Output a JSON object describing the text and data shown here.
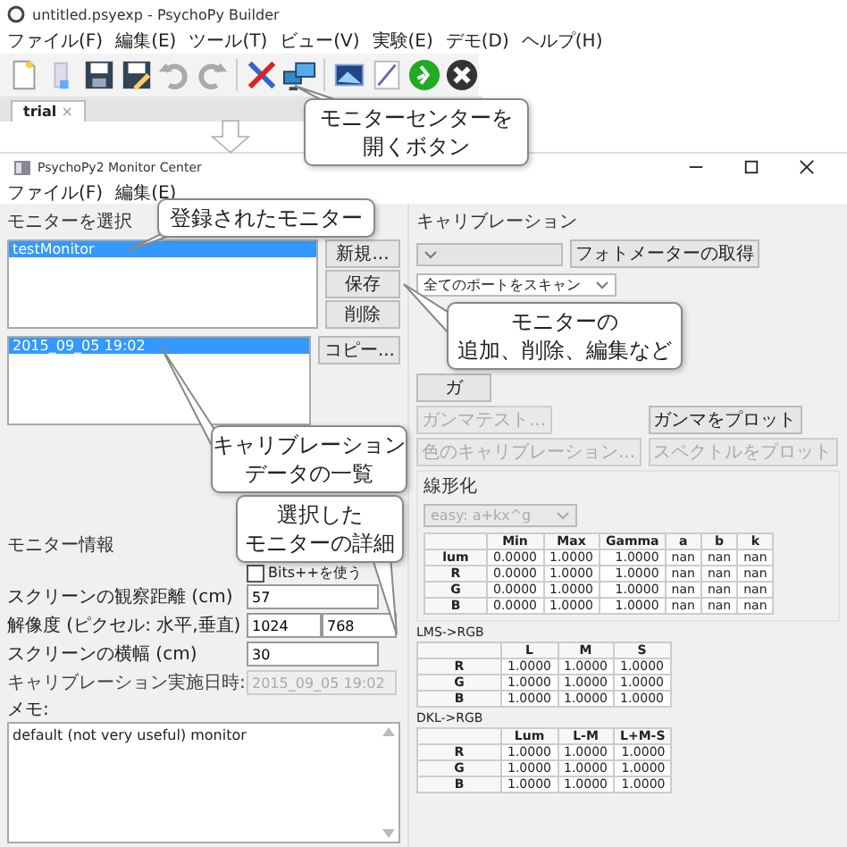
{
  "builder_window": {
    "title": "untitled.psyexp - PsychoPy Builder",
    "menu": [
      "ファイル(F)",
      "編集(E)",
      "ツール(T)",
      "ビュー(V)",
      "実験(E)",
      "デモ(D)",
      "ヘルプ(H)"
    ],
    "tabs": [
      {
        "label": "trial",
        "close": "×",
        "selected": true
      }
    ]
  },
  "monitor_center": {
    "title": "PsychoPy2 Monitor Center",
    "menu": [
      "ファイル(F)",
      "編集(E)"
    ],
    "select_panel": {
      "heading": "モニターを選択",
      "monitors": [
        {
          "name": "testMonitor",
          "selected": true
        }
      ],
      "monitor_buttons": [
        "新規...",
        "保存",
        "削除"
      ],
      "calibrations": [
        {
          "name": "2015_09_05 19:02",
          "selected": true
        }
      ],
      "calibration_buttons": [
        "コピー..."
      ]
    },
    "info_panel": {
      "heading": "モニター情報",
      "bits_checkbox": {
        "label": "Bits++を使う",
        "checked": false
      },
      "fields": [
        {
          "label": "スクリーンの観察距離 (cm)",
          "values": [
            "57"
          ],
          "disabled": false
        },
        {
          "label": "解像度 (ピクセル: 水平,垂直)",
          "values": [
            "1024",
            "768"
          ],
          "disabled": false
        },
        {
          "label": "スクリーンの横幅 (cm)",
          "values": [
            "30"
          ],
          "disabled": false
        },
        {
          "label": "キャリブレーション実施日時:",
          "values": [
            "2015_09_05 19:02"
          ],
          "disabled": true
        }
      ],
      "notes": {
        "label": "メモ:",
        "value": "default (not very useful) monitor"
      }
    },
    "calibration_panel": {
      "heading": "キャリブレーション",
      "photometer_button": "フォトメーターの取得",
      "port_select": "全てのポートをスキャン",
      "button_rows": [
        [
          {
            "label": "ガ",
            "disabled": false
          }
        ],
        [
          {
            "label": "ガンマテスト...",
            "disabled": true
          },
          {
            "label": "ガンマをプロット",
            "disabled": false
          }
        ],
        [
          {
            "label": "色のキャリブレーション...",
            "disabled": true
          },
          {
            "label": "スペクトルをプロット",
            "disabled": true
          }
        ]
      ],
      "linearization": {
        "heading": "線形化",
        "method": "easy: a+kx^g",
        "method_disabled": true,
        "columns": [
          "Min",
          "Max",
          "Gamma",
          "a",
          "b",
          "k"
        ],
        "rows": [
          {
            "label": "lum",
            "cells": [
              "0.0000",
              "1.0000",
              "1.0000",
              "nan",
              "nan",
              "nan"
            ]
          },
          {
            "label": "R",
            "cells": [
              "0.0000",
              "1.0000",
              "1.0000",
              "nan",
              "nan",
              "nan"
            ]
          },
          {
            "label": "G",
            "cells": [
              "0.0000",
              "1.0000",
              "1.0000",
              "nan",
              "nan",
              "nan"
            ]
          },
          {
            "label": "B",
            "cells": [
              "0.0000",
              "1.0000",
              "1.0000",
              "nan",
              "nan",
              "nan"
            ]
          }
        ]
      },
      "matrices": [
        {
          "title": "LMS->RGB",
          "columns": [
            "L",
            "M",
            "S"
          ],
          "rows": [
            {
              "label": "R",
              "cells": [
                "1.0000",
                "1.0000",
                "1.0000"
              ]
            },
            {
              "label": "G",
              "cells": [
                "1.0000",
                "1.0000",
                "1.0000"
              ]
            },
            {
              "label": "B",
              "cells": [
                "1.0000",
                "1.0000",
                "1.0000"
              ]
            }
          ]
        },
        {
          "title": "DKL->RGB",
          "columns": [
            "Lum",
            "L-M",
            "L+M-S"
          ],
          "rows": [
            {
              "label": "R",
              "cells": [
                "1.0000",
                "1.0000",
                "1.0000"
              ]
            },
            {
              "label": "G",
              "cells": [
                "1.0000",
                "1.0000",
                "1.0000"
              ]
            },
            {
              "label": "B",
              "cells": [
                "1.0000",
                "1.0000",
                "1.0000"
              ]
            }
          ]
        }
      ]
    }
  },
  "callouts": [
    {
      "lines": [
        "モニターセンターを",
        "開くボタン"
      ]
    },
    {
      "lines": [
        "登録されたモニター"
      ]
    },
    {
      "lines": [
        "モニターの",
        "追加、削除、編集など"
      ]
    },
    {
      "lines": [
        "キャリブレーション",
        "データの一覧"
      ]
    },
    {
      "lines": [
        "選択した",
        "モニターの詳細"
      ]
    }
  ]
}
